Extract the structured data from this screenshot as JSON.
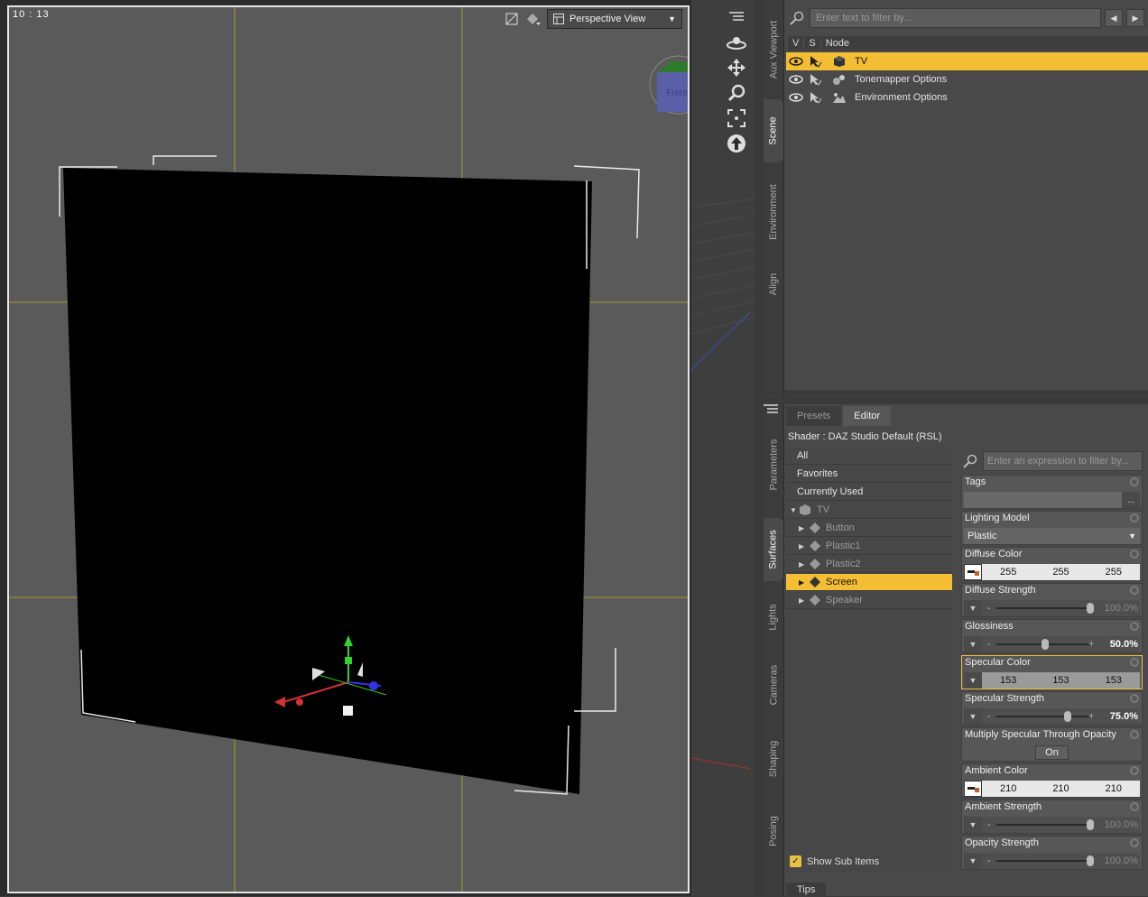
{
  "viewport": {
    "clock": "10 : 13",
    "view_label": "Perspective View",
    "cube_label": "Front"
  },
  "side_tabs_top": [
    "Aux Viewport",
    "Scene",
    "Environment",
    "Align"
  ],
  "side_tabs_bottom": [
    "Parameters",
    "Surfaces",
    "Lights",
    "Cameras",
    "Shaping",
    "Posing"
  ],
  "scene": {
    "filter_placeholder": "Enter text to filter by...",
    "headers": [
      "V",
      "S",
      "Node"
    ],
    "nodes": [
      {
        "name": "TV",
        "icon": "figure-cube-icon",
        "selected": true
      },
      {
        "name": "Tonemapper Options",
        "icon": "tonemapper-icon",
        "selected": false
      },
      {
        "name": "Environment Options",
        "icon": "environment-icon",
        "selected": false
      }
    ]
  },
  "surfaces": {
    "tabs": [
      "Presets",
      "Editor"
    ],
    "active_tab": "Editor",
    "shader": "Shader :  DAZ Studio Default (RSL)",
    "groups": [
      "All",
      "Favorites",
      "Currently Used"
    ],
    "root": "TV",
    "items": [
      "Button",
      "Plastic1",
      "Plastic2",
      "Screen",
      "Speaker"
    ],
    "selected_item": "Screen",
    "show_sub_items": "Show Sub Items",
    "tips": "Tips",
    "param_filter_placeholder": "Enter an expression to filter by...",
    "params": {
      "tags": {
        "label": "Tags",
        "more": "..."
      },
      "lighting_model": {
        "label": "Lighting Model",
        "value": "Plastic"
      },
      "diffuse_color": {
        "label": "Diffuse Color",
        "r": "255",
        "g": "255",
        "b": "255"
      },
      "diffuse_strength": {
        "label": "Diffuse Strength",
        "value": "100.0%",
        "fraction": 1.0
      },
      "glossiness": {
        "label": "Glossiness",
        "value": "50.0%",
        "fraction": 0.5
      },
      "specular_color": {
        "label": "Specular Color",
        "r": "153",
        "g": "153",
        "b": "153"
      },
      "specular_strength": {
        "label": "Specular Strength",
        "value": "75.0%",
        "fraction": 0.75
      },
      "multiply_specular": {
        "label": "Multiply Specular Through Opacity",
        "value": "On"
      },
      "ambient_color": {
        "label": "Ambient Color",
        "r": "210",
        "g": "210",
        "b": "210"
      },
      "ambient_strength": {
        "label": "Ambient Strength",
        "value": "100.0%",
        "fraction": 1.0
      },
      "opacity_strength": {
        "label": "Opacity Strength",
        "value": "100.0%",
        "fraction": 1.0
      }
    }
  },
  "colors": {
    "selection": "#f4be34",
    "panel": "#494949",
    "viewport_bg": "#5a5a5a"
  }
}
